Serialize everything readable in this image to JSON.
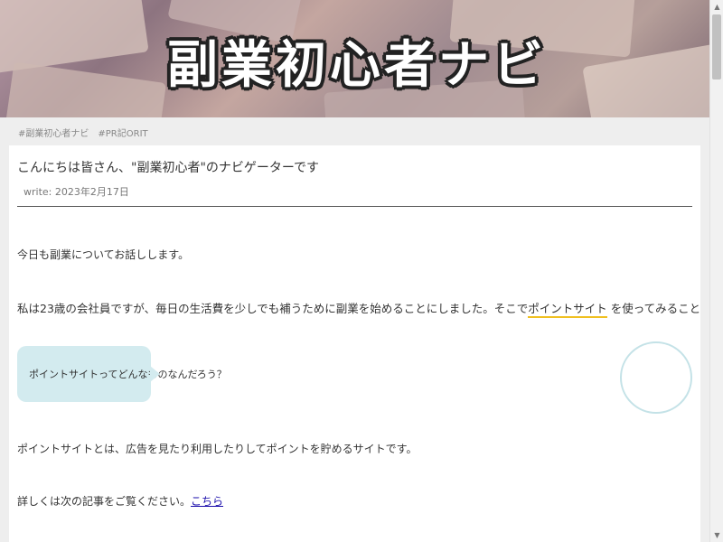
{
  "header": {
    "title": "副業初心者ナビ"
  },
  "tags": [
    "#副業初心者ナビ",
    "#PR記ORIT"
  ],
  "post": {
    "title": "こんにちは皆さん、\"副業初心者\"のナビゲーターです",
    "date": "write: 2023年2月17日",
    "paragraph1": "今日も副業についてお話しします。",
    "paragraph2_prefix": "私は23歳の会社員ですが、毎日の生活費を少しでも補うために副業を始めることにしました。そこで",
    "paragraph2_highlight": "ポイントサイト",
    "paragraph2_suffix": "を使ってみることにしました。",
    "bubble_text": "ポイントサイトってどんなものなんだろう？",
    "paragraph3": "ポイントサイトとは、広告を見たり利用したりしてポイントを貯めるサイトです。",
    "paragraph4_prefix": "詳しくは次の記事をご覧ください。",
    "paragraph4_link": "こちら"
  },
  "scrollbar": {
    "up_icon": "▲",
    "down_icon": "▼"
  }
}
